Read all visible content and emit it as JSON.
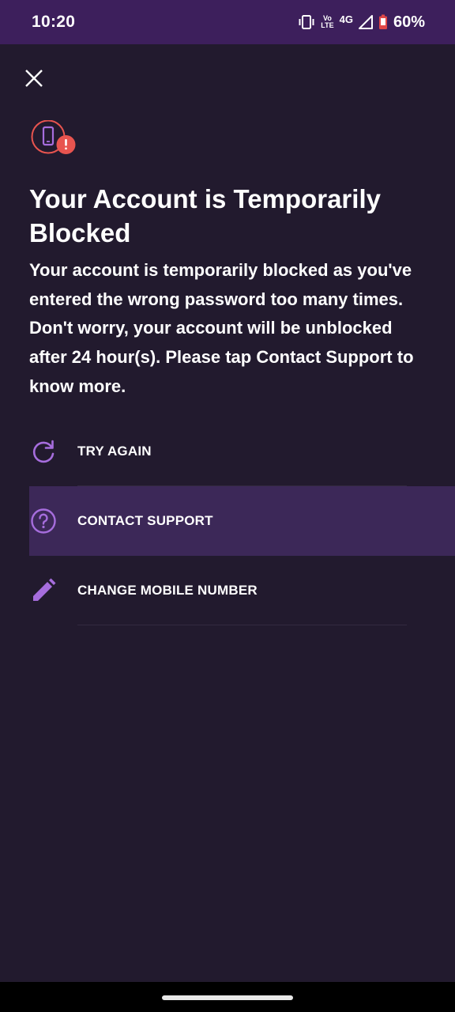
{
  "status_bar": {
    "time": "10:20",
    "volte_top": "Vo",
    "volte_bottom": "LTE",
    "network": "4G",
    "battery_percent": "60%",
    "icons": [
      "vibrate-icon",
      "volte-icon",
      "signal-icon",
      "battery-low-icon"
    ]
  },
  "header": {
    "close_icon": "close-icon",
    "alert_icon": "phone-alert-icon"
  },
  "main": {
    "title": "Your Account is Temporarily Blocked",
    "description": "Your account is temporarily blocked as you've entered the wrong password too many times. Don't worry, your account will be unblocked after 24 hour(s). Please tap Contact Support to know more."
  },
  "options": [
    {
      "label": "TRY AGAIN",
      "icon": "refresh-icon"
    },
    {
      "label": "CONTACT SUPPORT",
      "icon": "help-circle-icon",
      "highlighted": true
    },
    {
      "label": "CHANGE MOBILE NUMBER",
      "icon": "pencil-icon"
    }
  ],
  "colors": {
    "background": "#221a2e",
    "status_bar": "#3d1f5c",
    "accent": "#a66ddd",
    "alert_red": "#e8544f",
    "highlight_row": "#3c2858"
  }
}
